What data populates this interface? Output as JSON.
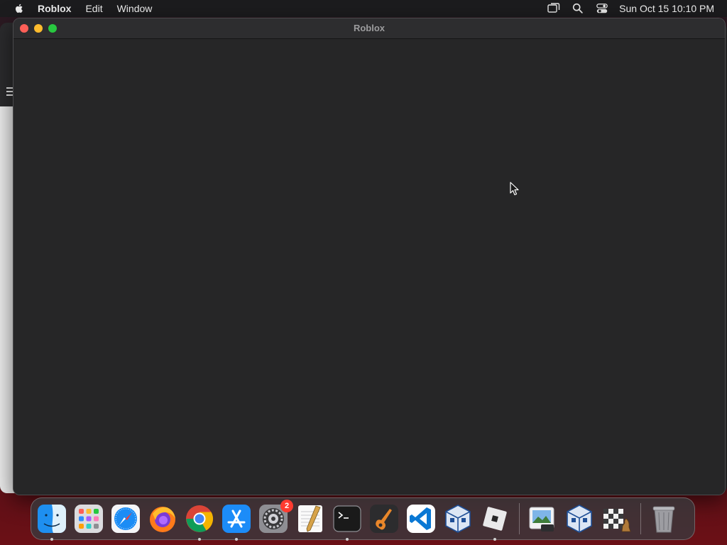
{
  "menubar": {
    "app_name": "Roblox",
    "items": [
      "Edit",
      "Window"
    ],
    "clock": "Sun Oct 15  10:10 PM",
    "tray_icons": [
      "screen-mirroring-icon",
      "spotlight-search-icon",
      "control-center-icon"
    ]
  },
  "window": {
    "title": "Roblox"
  },
  "dock": {
    "apps": [
      {
        "name": "Finder",
        "icon": "finder-icon",
        "running": true
      },
      {
        "name": "Launchpad",
        "icon": "launchpad-icon",
        "running": false
      },
      {
        "name": "Safari",
        "icon": "safari-icon",
        "running": false
      },
      {
        "name": "Firefox",
        "icon": "firefox-icon",
        "running": false
      },
      {
        "name": "Google Chrome",
        "icon": "chrome-icon",
        "running": true
      },
      {
        "name": "App Store",
        "icon": "app-store-icon",
        "running": true
      },
      {
        "name": "System Settings",
        "icon": "system-settings-icon",
        "running": false,
        "badge": "2"
      },
      {
        "name": "TextEdit",
        "icon": "textedit-icon",
        "running": false
      },
      {
        "name": "Terminal",
        "icon": "terminal-icon",
        "running": true
      },
      {
        "name": "GarageBand",
        "icon": "garageband-icon",
        "running": false
      },
      {
        "name": "Visual Studio Code",
        "icon": "vscode-icon",
        "running": false
      },
      {
        "name": "VirtualBox",
        "icon": "virtualbox-icon",
        "running": false
      },
      {
        "name": "Roblox",
        "icon": "roblox-icon",
        "running": true
      }
    ],
    "others": [
      {
        "name": "Preview",
        "icon": "preview-icon"
      },
      {
        "name": "VirtualBox",
        "icon": "virtualbox-icon"
      },
      {
        "name": "Chess",
        "icon": "chess-icon"
      },
      {
        "name": "Trash",
        "icon": "trash-icon"
      }
    ]
  },
  "colors": {
    "menubar_bg": "#1c1c1e",
    "window_bg": "#262627",
    "close": "#fe5f57",
    "minimize": "#febc2e",
    "zoom": "#28c840",
    "badge": "#ff3b30"
  }
}
